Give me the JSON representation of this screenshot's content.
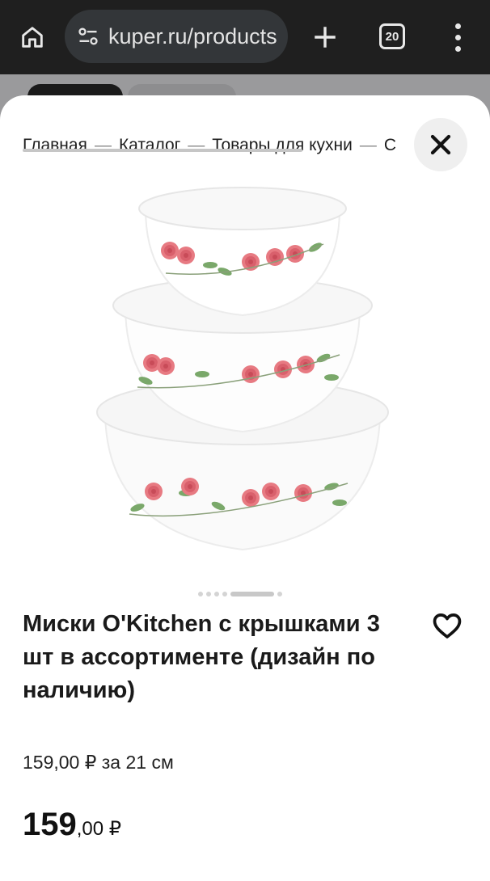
{
  "browser": {
    "url": "kuper.ru/products",
    "tab_count": "20",
    "icons": [
      "home-icon",
      "site-settings-icon",
      "plus-icon",
      "tabs-icon",
      "more-vert-icon"
    ]
  },
  "breadcrumb": {
    "items": [
      "Главная",
      "Каталог",
      "Товары для кухни",
      "С"
    ],
    "separator": "—"
  },
  "product": {
    "title": "Миски O'Kitchen с крышками 3 шт в ассортименте (дизайн по наличию)",
    "unit_price": "159,00 ₽ за 21 см",
    "price_main": "159",
    "price_fraction": ",00 ₽",
    "image_count": 6,
    "active_image": 5
  },
  "colors": {
    "topbar": "#1f1f1f",
    "urlbar": "#333639",
    "sheet": "#ffffff",
    "rose": "#e0707a",
    "leaf": "#6a9a5a"
  }
}
